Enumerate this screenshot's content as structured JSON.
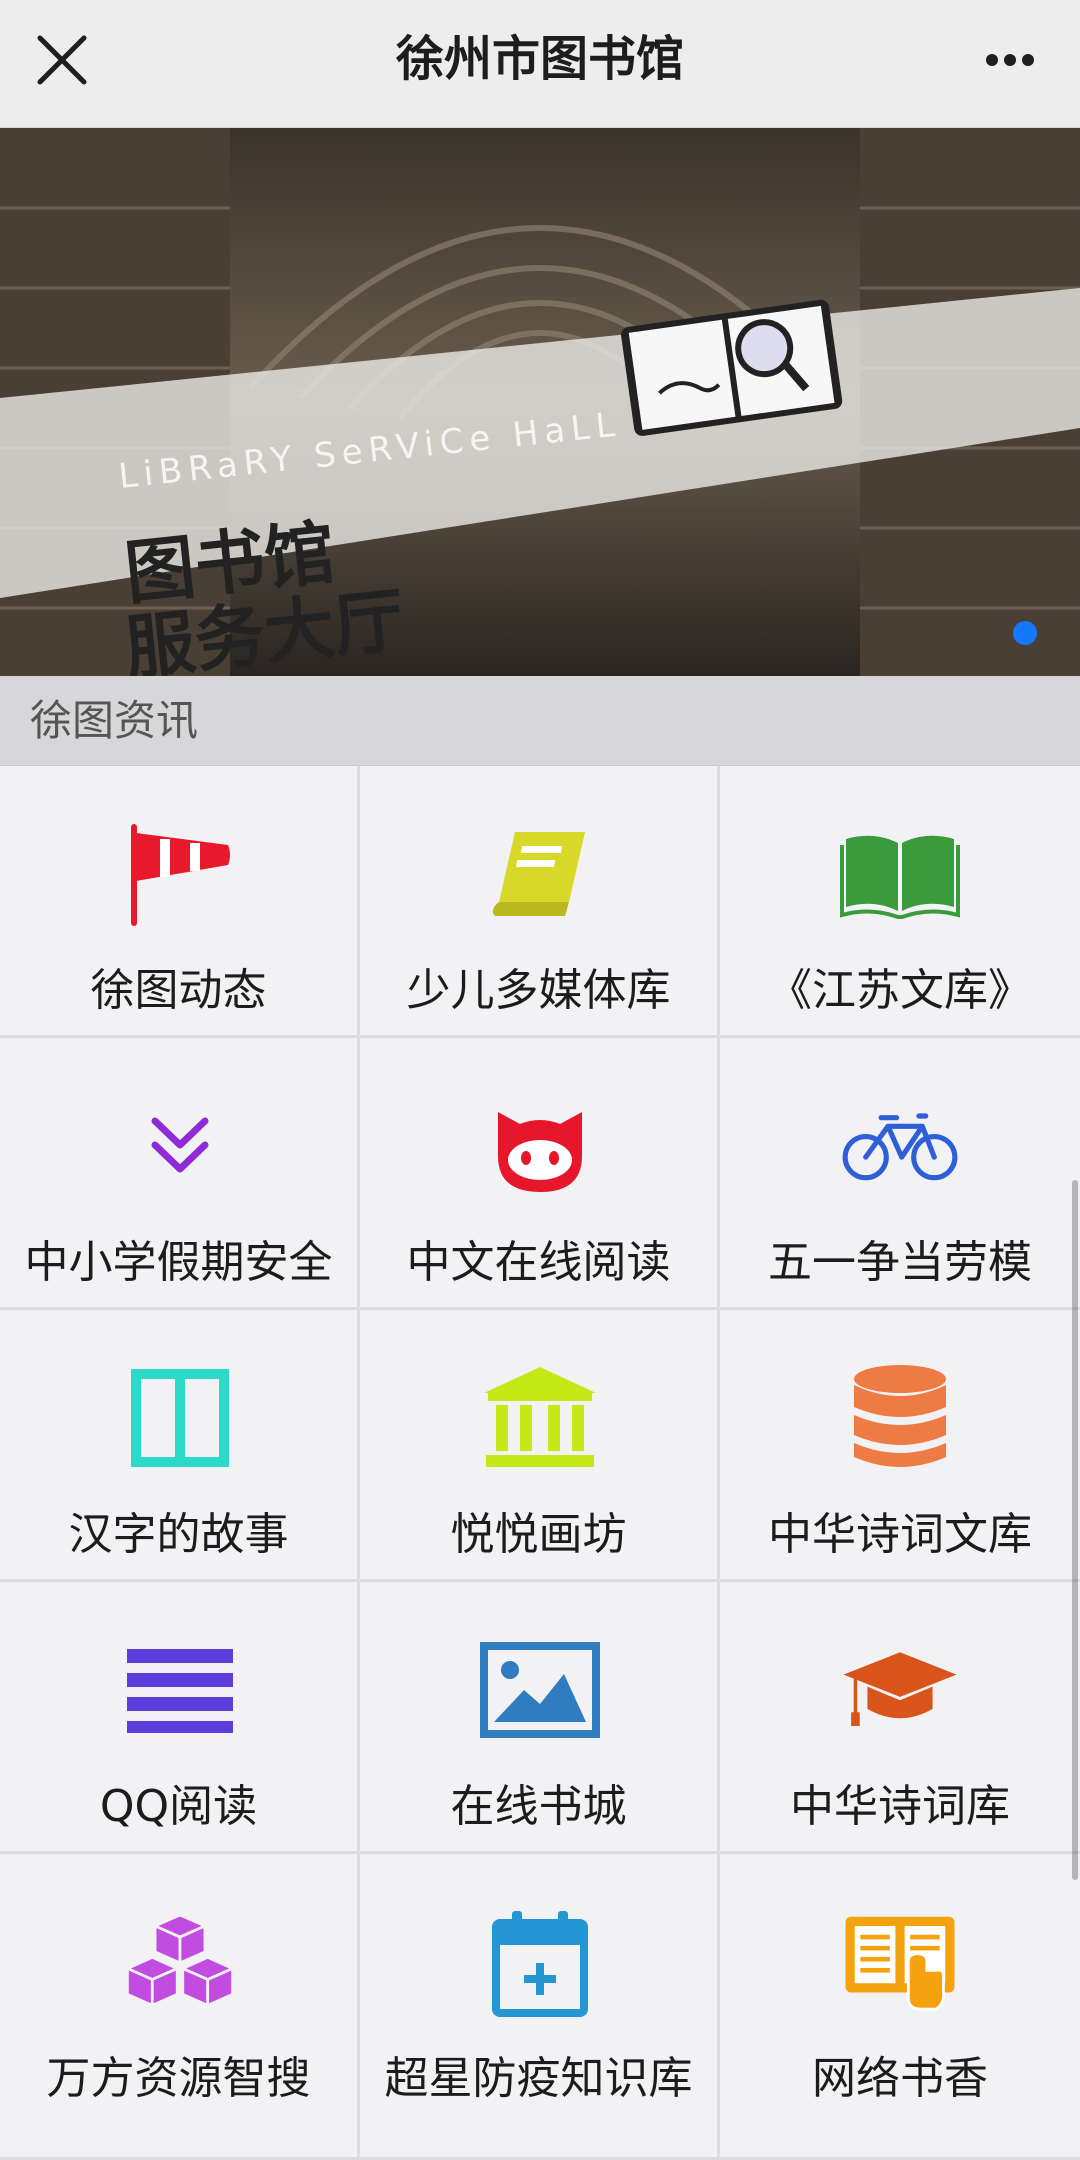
{
  "header": {
    "title": "徐州市图书馆"
  },
  "banner": {
    "line_en": "LiBRaRY SeRViCe HaLL",
    "line_cn_1": "图书馆",
    "line_cn_2": "服务大厅"
  },
  "section": {
    "title": "徐图资讯"
  },
  "grid": [
    {
      "label": "徐图动态",
      "icon": "windsock-icon",
      "color": "#e8192c"
    },
    {
      "label": "少儿多媒体库",
      "icon": "book-icon",
      "color": "#d8d829"
    },
    {
      "label": "《江苏文库》",
      "icon": "open-book-icon",
      "color": "#3a9b3d"
    },
    {
      "label": "中小学假期安全",
      "icon": "double-chevron-down-icon",
      "color": "#8e2bd6"
    },
    {
      "label": "中文在线阅读",
      "icon": "octocat-icon",
      "color": "#e6172a"
    },
    {
      "label": "五一争当劳模",
      "icon": "bicycle-icon",
      "color": "#2f5fd8"
    },
    {
      "label": "汉字的故事",
      "icon": "columns-icon",
      "color": "#2bd9c8"
    },
    {
      "label": "悦悦画坊",
      "icon": "bank-icon",
      "color": "#c5e817"
    },
    {
      "label": "中华诗词文库",
      "icon": "database-icon",
      "color": "#ee7a44"
    },
    {
      "label": "QQ阅读",
      "icon": "list-icon",
      "color": "#5b3ddb"
    },
    {
      "label": "在线书城",
      "icon": "image-icon",
      "color": "#2f7cc0"
    },
    {
      "label": "中华诗词库",
      "icon": "graduation-cap-icon",
      "color": "#d8541a"
    },
    {
      "label": "万方资源智搜",
      "icon": "cubes-icon",
      "color": "#c24be0"
    },
    {
      "label": "超星防疫知识库",
      "icon": "calendar-plus-icon",
      "color": "#2596d4"
    },
    {
      "label": "网络书香",
      "icon": "reading-icon",
      "color": "#f4a30f"
    }
  ]
}
